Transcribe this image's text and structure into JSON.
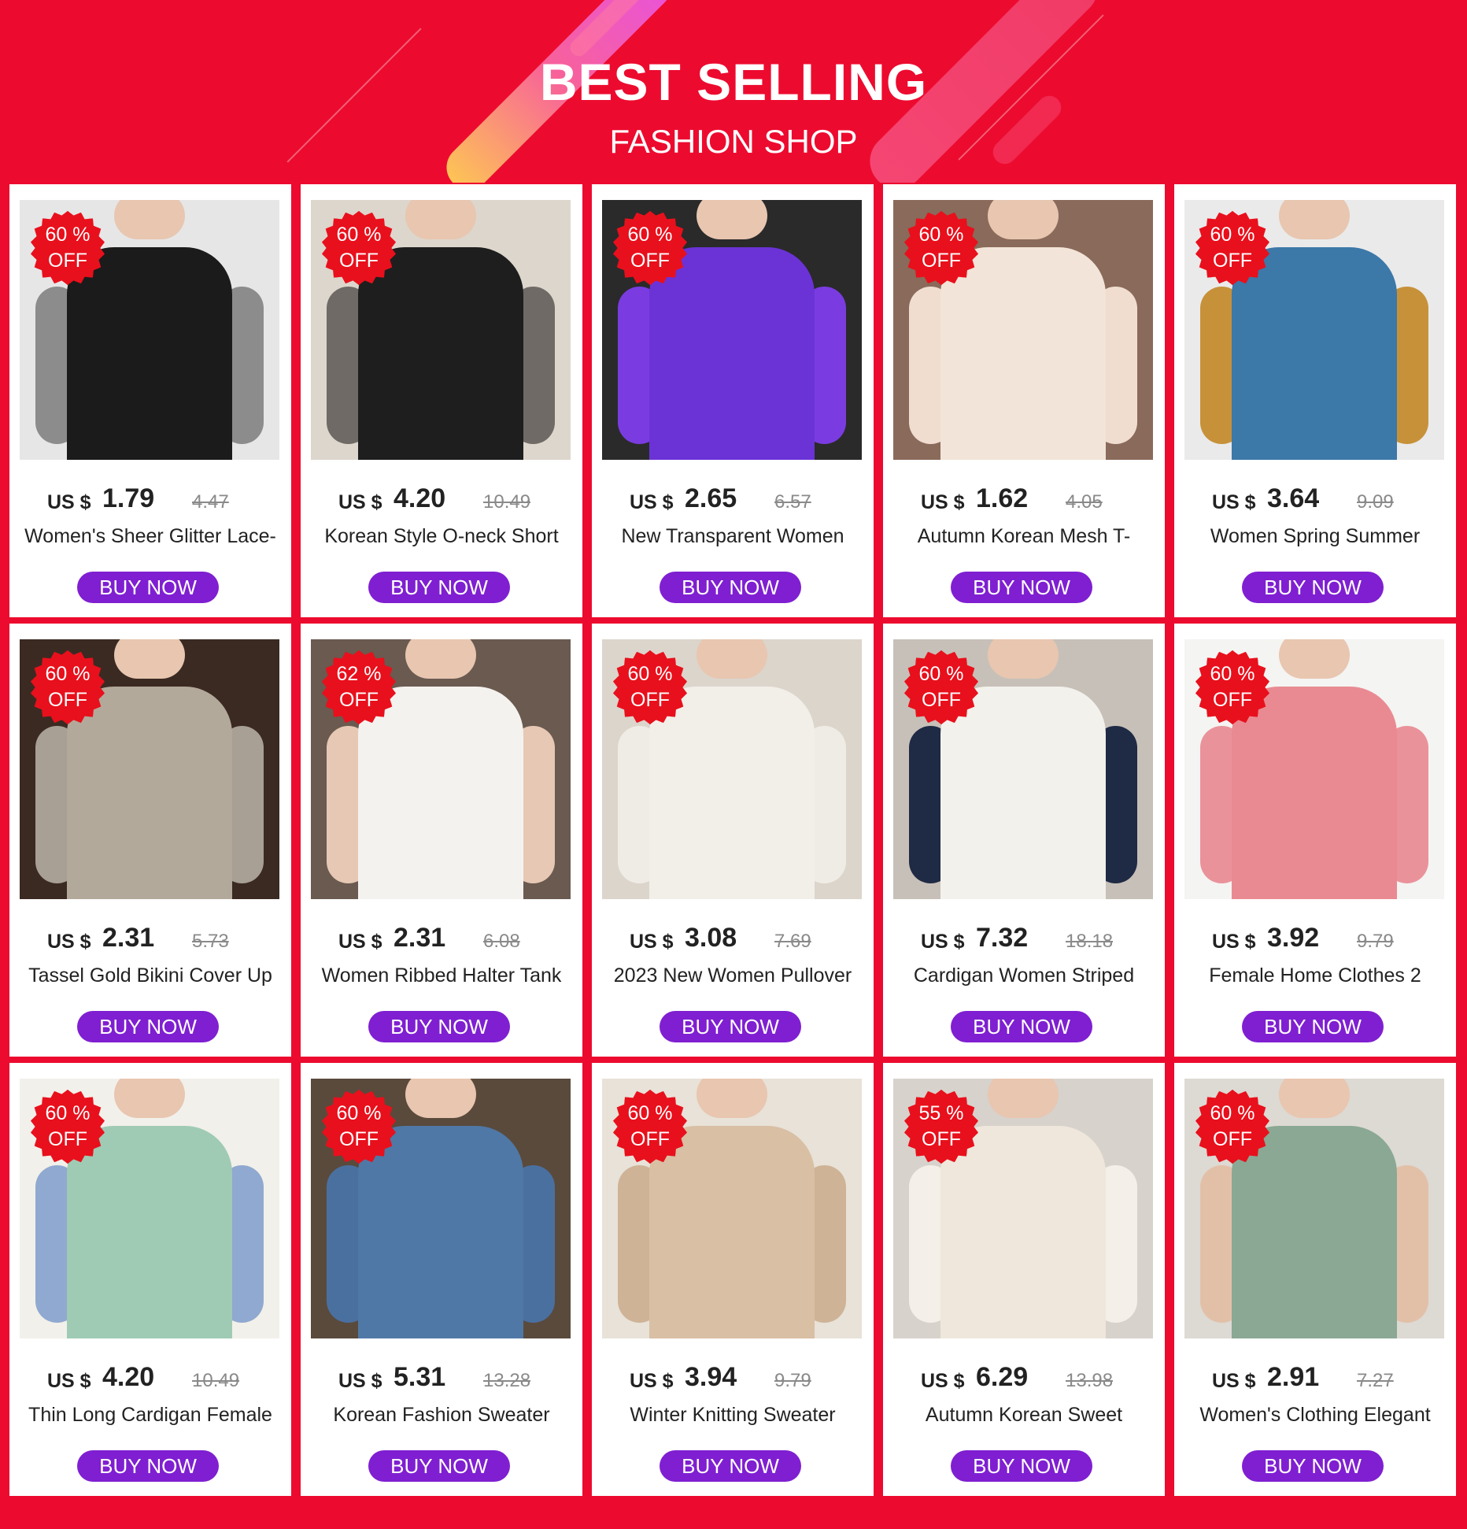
{
  "header": {
    "title": "BEST SELLING",
    "subtitle": "FASHION SHOP"
  },
  "colors": {
    "background": "#ec0b2f",
    "badge": "#e8101c",
    "button": "#7f1fd1"
  },
  "currency_label": "US $",
  "products": [
    {
      "badge_pct": "60 %",
      "badge_off": "OFF",
      "price": "1.79",
      "old_price": "4.47",
      "name": "Women's Sheer Glitter Lace-",
      "button": "BUY NOW"
    },
    {
      "badge_pct": "60 %",
      "badge_off": "OFF",
      "price": "4.20",
      "old_price": "10.49",
      "name": "Korean Style O-neck Short",
      "button": "BUY NOW"
    },
    {
      "badge_pct": "60 %",
      "badge_off": "OFF",
      "price": "2.65",
      "old_price": "6.57",
      "name": "New Transparent Women",
      "button": "BUY NOW"
    },
    {
      "badge_pct": "60 %",
      "badge_off": "OFF",
      "price": "1.62",
      "old_price": "4.05",
      "name": "Autumn Korean Mesh T-",
      "button": "BUY NOW"
    },
    {
      "badge_pct": "60 %",
      "badge_off": "OFF",
      "price": "3.64",
      "old_price": "9.09",
      "name": "Women Spring Summer",
      "button": "BUY NOW"
    },
    {
      "badge_pct": "60 %",
      "badge_off": "OFF",
      "price": "2.31",
      "old_price": "5.73",
      "name": "Tassel Gold Bikini Cover Up",
      "button": "BUY NOW"
    },
    {
      "badge_pct": "62 %",
      "badge_off": "OFF",
      "price": "2.31",
      "old_price": "6.08",
      "name": "Women Ribbed Halter Tank",
      "button": "BUY NOW"
    },
    {
      "badge_pct": "60 %",
      "badge_off": "OFF",
      "price": "3.08",
      "old_price": "7.69",
      "name": "2023 New Women Pullover",
      "button": "BUY NOW"
    },
    {
      "badge_pct": "60 %",
      "badge_off": "OFF",
      "price": "7.32",
      "old_price": "18.18",
      "name": "Cardigan Women Striped",
      "button": "BUY NOW"
    },
    {
      "badge_pct": "60 %",
      "badge_off": "OFF",
      "price": "3.92",
      "old_price": "9.79",
      "name": "Female Home Clothes 2",
      "button": "BUY NOW"
    },
    {
      "badge_pct": "60 %",
      "badge_off": "OFF",
      "price": "4.20",
      "old_price": "10.49",
      "name": "Thin Long Cardigan Female",
      "button": "BUY NOW"
    },
    {
      "badge_pct": "60 %",
      "badge_off": "OFF",
      "price": "5.31",
      "old_price": "13.28",
      "name": "Korean Fashion Sweater",
      "button": "BUY NOW"
    },
    {
      "badge_pct": "60 %",
      "badge_off": "OFF",
      "price": "3.94",
      "old_price": "9.79",
      "name": "Winter Knitting Sweater",
      "button": "BUY NOW"
    },
    {
      "badge_pct": "55 %",
      "badge_off": "OFF",
      "price": "6.29",
      "old_price": "13.98",
      "name": "Autumn Korean Sweet",
      "button": "BUY NOW"
    },
    {
      "badge_pct": "60 %",
      "badge_off": "OFF",
      "price": "2.91",
      "old_price": "7.27",
      "name": "Women's Clothing Elegant",
      "button": "BUY NOW"
    }
  ],
  "photo_colors": [
    {
      "bg": "#e6e6e6",
      "garment": "#1b1b1b",
      "arms": "#8c8c8c"
    },
    {
      "bg": "#ddd6cc",
      "garment": "#1e1e1e",
      "arms": "#6f6a66"
    },
    {
      "bg": "#2a2a2a",
      "garment": "#6b33d6",
      "arms": "#7a3ce0"
    },
    {
      "bg": "#8a6a5a",
      "garment": "#f2e4d8",
      "arms": "#f0ddd0"
    },
    {
      "bg": "#eaeaea",
      "garment": "#3c78a8",
      "arms": "#c7913a"
    },
    {
      "bg": "#3b2a22",
      "garment": "#b3a99a",
      "arms": "#a8a094"
    },
    {
      "bg": "#6a5a50",
      "garment": "#f4f2ee",
      "arms": "#e7c8b4"
    },
    {
      "bg": "#dcd5cc",
      "garment": "#f2efe9",
      "arms": "#efece6"
    },
    {
      "bg": "#c7c0b8",
      "garment": "#f3f1ec",
      "arms": "#1f2a44"
    },
    {
      "bg": "#f4f4f2",
      "garment": "#e98a92",
      "arms": "#ea929a"
    },
    {
      "bg": "#f2f0ea",
      "garment": "#9fcbb4",
      "arms": "#8fa9d0"
    },
    {
      "bg": "#5a4a3c",
      "garment": "#4f78a6",
      "arms": "#4a70a0"
    },
    {
      "bg": "#e8e2d8",
      "garment": "#d9bfa4",
      "arms": "#cfb397"
    },
    {
      "bg": "#d7d2cc",
      "garment": "#efe7dc",
      "arms": "#f4efe8"
    },
    {
      "bg": "#ddd9d3",
      "garment": "#8aa894",
      "arms": "#e2c0a8"
    }
  ]
}
